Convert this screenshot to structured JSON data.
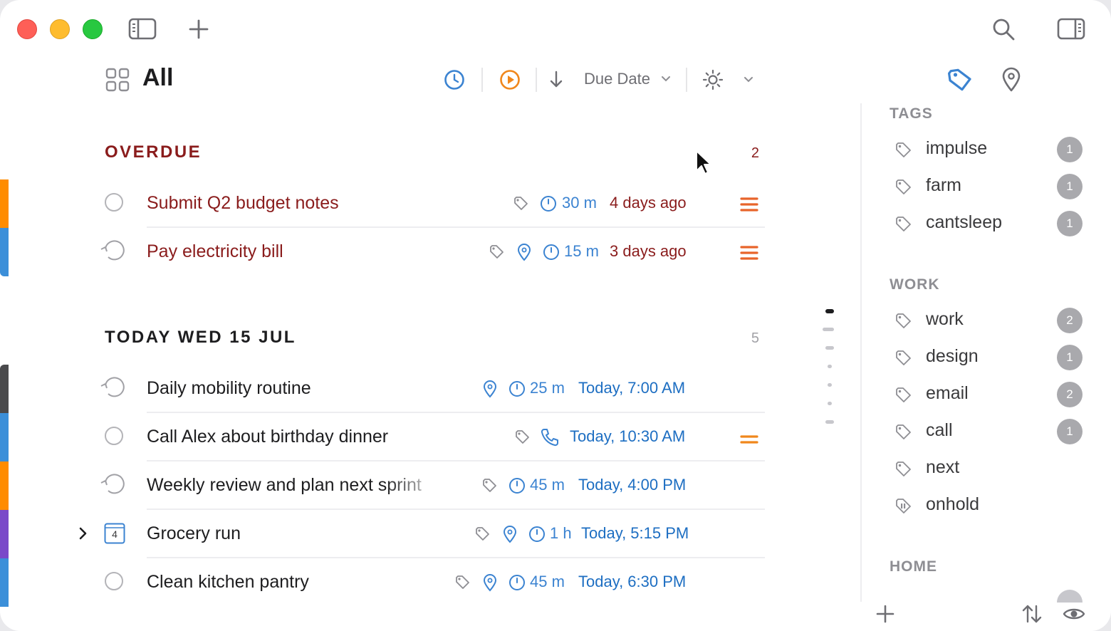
{
  "header": {
    "title": "All",
    "sort_label": "Due Date"
  },
  "sections": [
    {
      "title": "OVERDUE",
      "count": "2",
      "tasks": [
        {
          "name": "Submit Q2 budget notes",
          "duration": "30 m",
          "due": "4 days ago",
          "color": "#ff8c00"
        },
        {
          "name": "Pay electricity bill",
          "duration": "15 m",
          "due": "3 days ago",
          "color": "#3b8fd9"
        }
      ]
    },
    {
      "title": "TODAY WED 15 JUL",
      "count": "5",
      "tasks": [
        {
          "name": "Daily mobility routine",
          "duration": "25 m",
          "due": "Today, 7:00 AM",
          "color": "#4a4a4c"
        },
        {
          "name": "Call Alex about birthday dinner",
          "due": "Today, 10:30 AM",
          "color": "#3b8fd9"
        },
        {
          "name": "Weekly review and plan next sprint",
          "duration": "45 m",
          "due": "Today, 4:00 PM",
          "color": "#ff8c00"
        },
        {
          "name": "Grocery run",
          "duration": "1 h",
          "due": "Today, 5:15 PM",
          "color": "#7a49c9",
          "subtask_count": "4"
        },
        {
          "name": "Clean kitchen pantry",
          "duration": "45 m",
          "due": "Today, 6:30 PM",
          "color": "#3b8fd9"
        }
      ]
    }
  ],
  "sidebar": {
    "tags_heading": "TAGS",
    "tags": [
      {
        "name": "impulse",
        "count": "1"
      },
      {
        "name": "farm",
        "count": "1"
      },
      {
        "name": "cantsleep",
        "count": "1"
      }
    ],
    "work_heading": "WORK",
    "work": [
      {
        "name": "work",
        "count": "2"
      },
      {
        "name": "design",
        "count": "1"
      },
      {
        "name": "email",
        "count": "2"
      },
      {
        "name": "call",
        "count": "1"
      },
      {
        "name": "next"
      },
      {
        "name": "onhold"
      }
    ],
    "home_heading": "HOME"
  },
  "colors": {
    "overdue": "#8a1c1c",
    "accent_blue": "#3b83d1",
    "priority_orange": "#e8642a"
  }
}
